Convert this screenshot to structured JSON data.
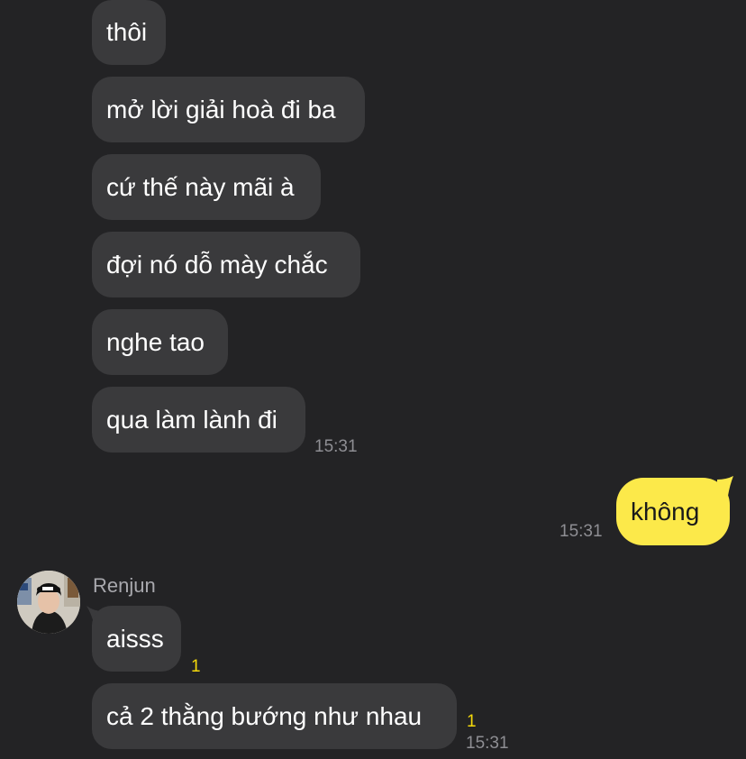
{
  "colors": {
    "background": "#232325",
    "incoming_bubble": "#3a3a3c",
    "outgoing_bubble": "#fce94a",
    "timestamp": "#8e8e93",
    "unread_count": "#f5d90a",
    "sender_name": "#a8a8ad"
  },
  "messages": [
    {
      "text": "thôi"
    },
    {
      "text": "mở lời giải hoà đi ba"
    },
    {
      "text": "cứ thế này mãi à"
    },
    {
      "text": "đợi nó dỗ mày chắc"
    },
    {
      "text": "nghe tao"
    },
    {
      "text": "qua làm lành đi",
      "time": "15:31"
    },
    {
      "text": "không",
      "time": "15:31"
    },
    {
      "text": "aisss",
      "unread": "1"
    },
    {
      "text": "cả 2 thằng bướng như nhau",
      "unread": "1",
      "time": "15:31"
    }
  ],
  "sender": {
    "name": "Renjun",
    "avatar_icon": "profile-avatar"
  }
}
